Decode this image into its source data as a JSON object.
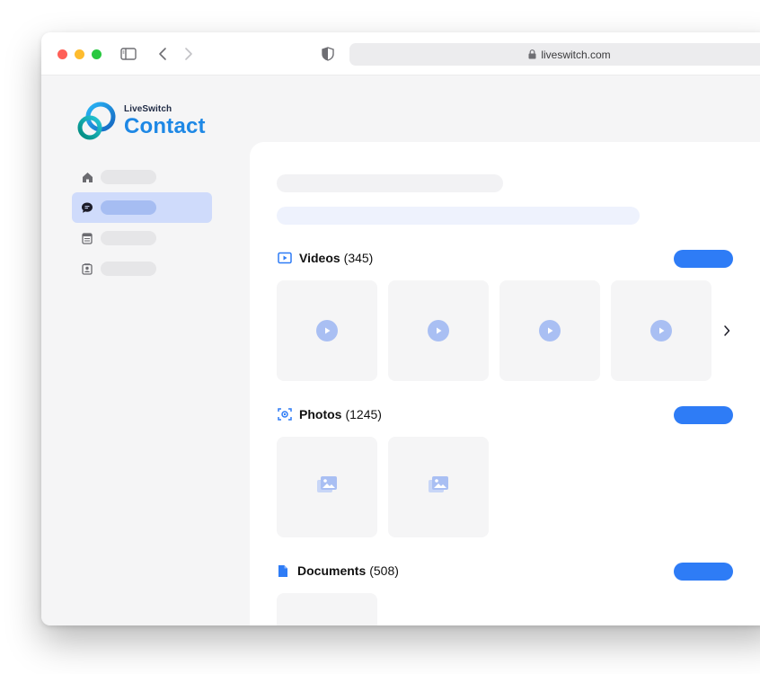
{
  "browser": {
    "url": "liveswitch.com"
  },
  "logo": {
    "brand": "LiveSwitch",
    "product": "Contact"
  },
  "sections": {
    "videos": {
      "title": "Videos",
      "count": "(345)"
    },
    "photos": {
      "title": "Photos",
      "count": "(1245)"
    },
    "documents": {
      "title": "Documents",
      "count": "(508)"
    }
  },
  "colors": {
    "accent": "#2e7cf6",
    "brand": "#1e88e5",
    "active_nav_bg": "#cfdbfb"
  },
  "icons": {
    "nav": [
      "home-icon",
      "chat-icon",
      "document-icon",
      "contact-card-icon"
    ],
    "sections": [
      "video-icon",
      "camera-icon",
      "file-icon"
    ]
  }
}
